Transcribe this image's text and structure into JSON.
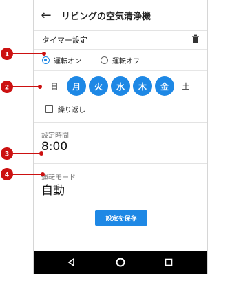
{
  "header": {
    "title": "リビングの空気清浄機",
    "back_icon": "arrow-left-icon"
  },
  "timer": {
    "label": "タイマー設定",
    "delete_icon": "trash-icon"
  },
  "mode_radio": [
    {
      "label": "運転オン",
      "selected": true
    },
    {
      "label": "運転オフ",
      "selected": false
    }
  ],
  "days": [
    {
      "label": "日",
      "selected": false
    },
    {
      "label": "月",
      "selected": true
    },
    {
      "label": "火",
      "selected": true
    },
    {
      "label": "水",
      "selected": true
    },
    {
      "label": "木",
      "selected": true
    },
    {
      "label": "金",
      "selected": true
    },
    {
      "label": "土",
      "selected": false
    }
  ],
  "repeat": {
    "label": "繰り返し",
    "checked": false
  },
  "time": {
    "label": "設定時間",
    "value": "8:00"
  },
  "operation_mode": {
    "label": "運転モード",
    "value": "自動"
  },
  "save_button": {
    "label": "設定を保存"
  },
  "markers": [
    "1",
    "2",
    "3",
    "4"
  ],
  "colors": {
    "accent": "#1e88e5",
    "marker": "#cc1111",
    "navbar": "#000000"
  },
  "navbar": {
    "back_icon": "triangle-back-icon",
    "home_icon": "circle-home-icon",
    "recents_icon": "square-recents-icon"
  }
}
